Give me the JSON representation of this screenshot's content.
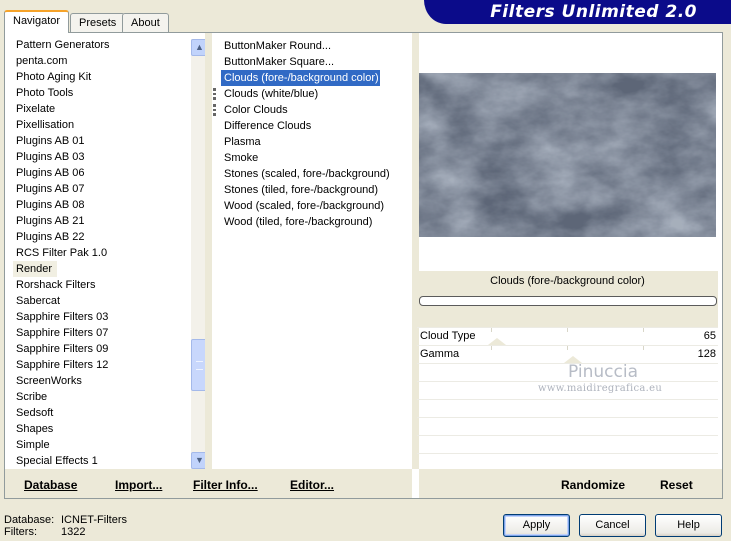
{
  "app_title": "Filters Unlimited 2.0",
  "tabs": [
    {
      "label": "Navigator",
      "active": true
    },
    {
      "label": "Presets",
      "active": false
    },
    {
      "label": "About",
      "active": false
    }
  ],
  "categories": [
    "Pattern Generators",
    "penta.com",
    "Photo Aging Kit",
    "Photo Tools",
    "Pixelate",
    "Pixellisation",
    "Plugins AB 01",
    "Plugins AB 03",
    "Plugins AB 06",
    "Plugins AB 07",
    "Plugins AB 08",
    "Plugins AB 21",
    "Plugins AB 22",
    "RCS Filter Pak 1.0",
    "Render",
    "Rorshack Filters",
    "Sabercat",
    "Sapphire Filters 03",
    "Sapphire Filters 07",
    "Sapphire Filters 09",
    "Sapphire Filters 12",
    "ScreenWorks",
    "Scribe",
    "Sedsoft",
    "Shapes",
    "Simple",
    "Special Effects 1"
  ],
  "selected_category": "Render",
  "filters": [
    {
      "label": "ButtonMaker Round...",
      "marked": false
    },
    {
      "label": "ButtonMaker Square...",
      "marked": false
    },
    {
      "label": "Clouds (fore-/background color)",
      "marked": false
    },
    {
      "label": "Clouds (white/blue)",
      "marked": true
    },
    {
      "label": "Color Clouds",
      "marked": true
    },
    {
      "label": "Difference Clouds",
      "marked": false
    },
    {
      "label": "Plasma",
      "marked": false
    },
    {
      "label": "Smoke",
      "marked": false
    },
    {
      "label": "Stones (scaled, fore-/background)",
      "marked": false
    },
    {
      "label": "Stones (tiled, fore-/background)",
      "marked": false
    },
    {
      "label": "Wood (scaled, fore-/background)",
      "marked": false
    },
    {
      "label": "Wood (tiled, fore-/background)",
      "marked": false
    }
  ],
  "selected_filter": "Clouds (fore-/background color)",
  "preview_filter_name": "Clouds (fore-/background color)",
  "params": [
    {
      "label": "Cloud Type",
      "value": "65"
    },
    {
      "label": "Gamma",
      "value": "128"
    }
  ],
  "watermark": {
    "name": "Pinuccia",
    "url": "www.maidiregrafica.eu"
  },
  "toolbar": {
    "database": "Database",
    "import": "Import...",
    "filter_info": "Filter Info...",
    "editor": "Editor...",
    "randomize": "Randomize",
    "reset": "Reset"
  },
  "status": {
    "database_label": "Database:",
    "database_value": "ICNET-Filters",
    "filters_label": "Filters:",
    "filters_value": "1322"
  },
  "buttons": {
    "apply": "Apply",
    "cancel": "Cancel",
    "help": "Help"
  },
  "colors": {
    "banner": "#0b0b8a",
    "selection": "#316ac5",
    "panel": "#ece9d8"
  }
}
